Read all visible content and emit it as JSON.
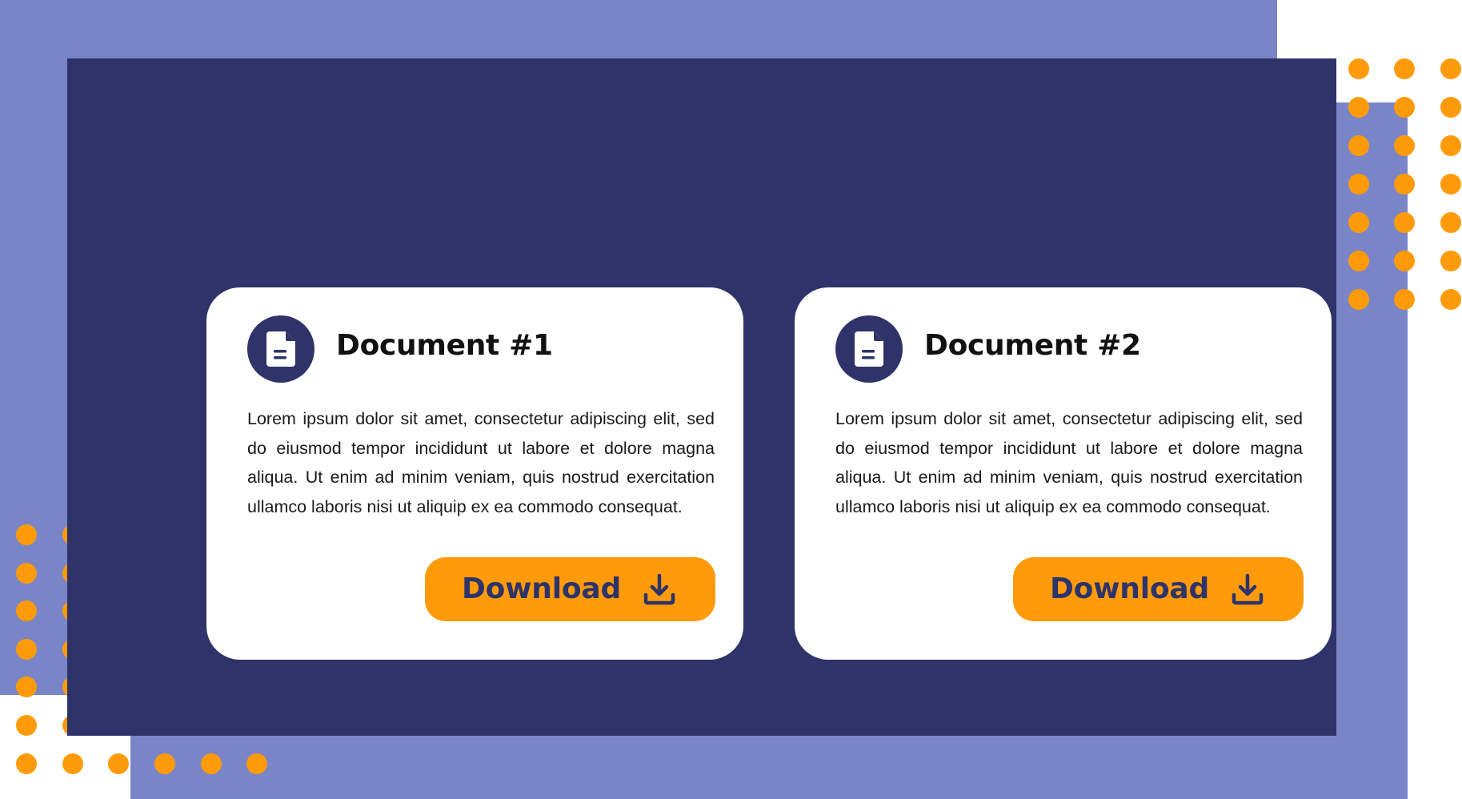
{
  "colors": {
    "background_lavender": "#7985c6",
    "panel_navy": "#2e3369",
    "accent_orange": "#ff9b0a",
    "card_white": "#ffffff"
  },
  "documents": [
    {
      "title": "Document #1",
      "icon": "document-icon",
      "body": "Lorem ipsum dolor sit amet, consectetur adipiscing elit, sed do eiusmod tempor incididunt ut labore et dolore magna aliqua. Ut enim ad minim veniam, quis nostrud exercitation ullamco laboris nisi ut aliquip ex ea commodo consequat.",
      "button_label": "Download",
      "button_icon": "download-icon"
    },
    {
      "title": "Document #2",
      "icon": "document-icon",
      "body": "Lorem ipsum dolor sit amet, consectetur adipiscing elit, sed do eiusmod tempor incididunt ut labore et dolore magna aliqua. Ut enim ad minim veniam, quis nostrud exercitation ullamco laboris nisi ut aliquip ex ea commodo consequat.",
      "button_label": "Download",
      "button_icon": "download-icon"
    }
  ]
}
